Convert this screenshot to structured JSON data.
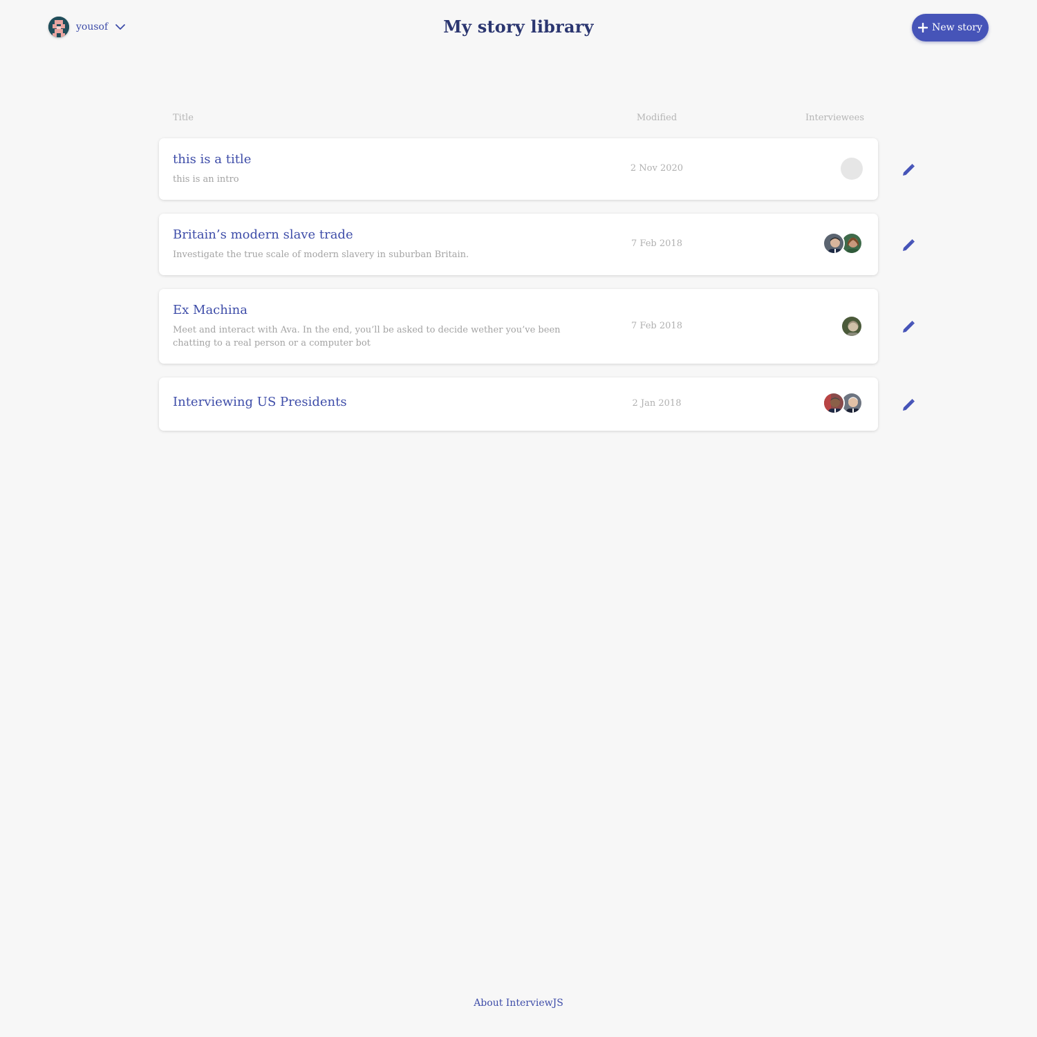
{
  "header": {
    "user_name": "yousof",
    "title": "My story library",
    "new_story_label": "New story"
  },
  "columns": {
    "title": "Title",
    "modified": "Modified",
    "interviewees": "Interviewees"
  },
  "stories": [
    {
      "title": "this is a title",
      "intro": "this is an intro",
      "modified": "2 Nov 2020",
      "interviewee_count": 0
    },
    {
      "title": "Britain’s modern slave trade",
      "intro": "Investigate the true scale of modern slavery in suburban Britain.",
      "modified": "7 Feb 2018",
      "interviewee_count": 2
    },
    {
      "title": "Ex Machina",
      "intro": "Meet and interact with Ava. In the end, you’ll be asked to decide wether you’ve been chatting to a real person or a computer bot",
      "modified": "7 Feb 2018",
      "interviewee_count": 1
    },
    {
      "title": "Interviewing US Presidents",
      "intro": "",
      "modified": "2 Jan 2018",
      "interviewee_count": 2
    }
  ],
  "footer": {
    "about_label": "About InterviewJS"
  },
  "colors": {
    "accent": "#4654b8",
    "title_text": "#2b3670",
    "link": "#3d4ca8",
    "background": "#f7f7f7"
  },
  "icons": {
    "user_menu": "chevron-down-icon",
    "new_story": "plus-icon",
    "edit": "pencil-icon"
  }
}
